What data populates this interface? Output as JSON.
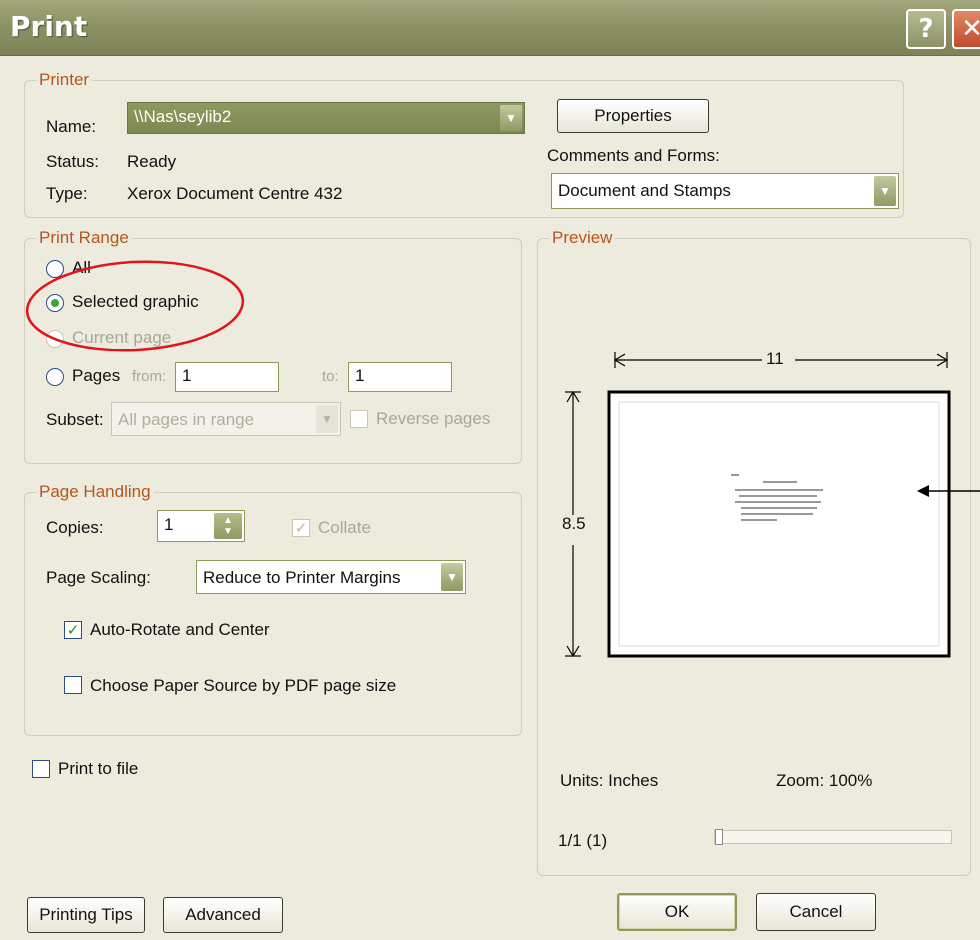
{
  "window": {
    "title": "Print"
  },
  "printer": {
    "legend": "Printer",
    "name_label": "Name:",
    "name_value": "\\\\Nas\\seylib2",
    "status_label": "Status:",
    "status_value": "Ready",
    "type_label": "Type:",
    "type_value": "Xerox Document Centre 432",
    "properties_button": "Properties",
    "comments_label": "Comments and Forms:",
    "comments_value": "Document and Stamps"
  },
  "print_range": {
    "legend": "Print Range",
    "all": "All",
    "selected_graphic": "Selected graphic",
    "current_page": "Current page",
    "pages": "Pages",
    "from_label": "from:",
    "from_value": "1",
    "to_label": "to:",
    "to_value": "1",
    "subset_label": "Subset:",
    "subset_value": "All pages in range",
    "reverse_pages": "Reverse pages",
    "selected_option": "selected_graphic"
  },
  "page_handling": {
    "legend": "Page Handling",
    "copies_label": "Copies:",
    "copies_value": "1",
    "collate": "Collate",
    "scaling_label": "Page Scaling:",
    "scaling_value": "Reduce to Printer Margins",
    "auto_rotate": "Auto-Rotate and Center",
    "auto_rotate_checked": true,
    "paper_source": "Choose Paper Source by PDF page size",
    "paper_source_checked": false
  },
  "print_to_file": {
    "label": "Print to file",
    "checked": false
  },
  "preview": {
    "legend": "Preview",
    "width_dim": "11",
    "height_dim": "8.5",
    "units": "Units: Inches",
    "zoom": "Zoom: 100%",
    "page_counter": "1/1 (1)"
  },
  "buttons": {
    "printing_tips": "Printing Tips",
    "advanced": "Advanced",
    "ok": "OK",
    "cancel": "Cancel"
  },
  "colors": {
    "titlebar": "#8e9366",
    "legend_text": "#b5561f",
    "annotation_circle": "#e0151b"
  }
}
